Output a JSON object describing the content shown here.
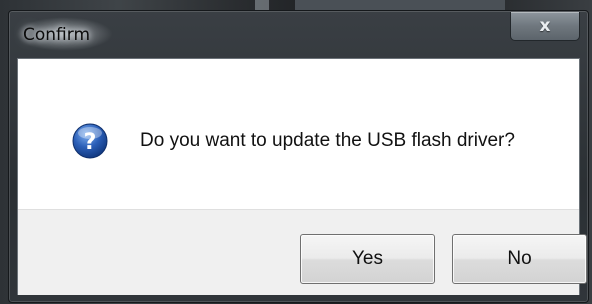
{
  "dialog": {
    "title": "Confirm",
    "close_glyph": "x",
    "message": "Do you want to update the USB flash driver?",
    "icon": "question-icon",
    "buttons": {
      "yes_label": "Yes",
      "no_label": "No"
    }
  },
  "colors": {
    "icon_blue": "#2b5fb8",
    "button_area": "#f0f0f0"
  }
}
